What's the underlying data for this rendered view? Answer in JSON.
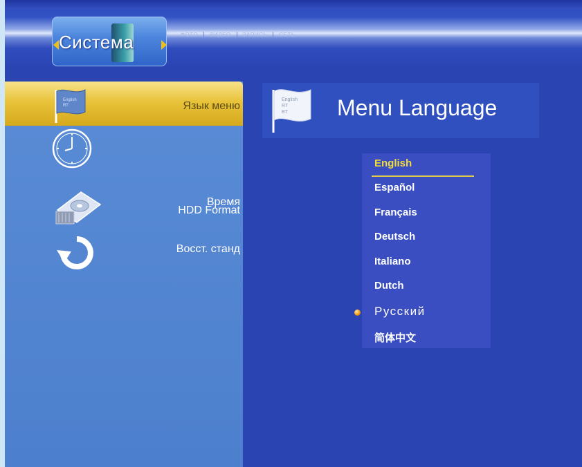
{
  "header": {
    "title": "Система",
    "tabs": [
      "ФОТО",
      "ВИДЕО",
      "ЗАПИСЬ",
      "СЕТЬ"
    ]
  },
  "menu": {
    "items": [
      {
        "label": "Язык меню",
        "icon": "flag-icon",
        "selected": true
      },
      {
        "label": "Время",
        "icon": "clock-icon",
        "selected": false
      },
      {
        "label": "HDD Format",
        "icon": "hard-drive-icon",
        "selected": false
      },
      {
        "label": "Восст. станд",
        "icon": "restore-icon",
        "selected": false
      }
    ]
  },
  "content": {
    "title": "Menu Language",
    "icon": "flag-icon",
    "languages": [
      "English",
      "Español",
      "Français",
      "Deutsch",
      "Italiano",
      "Dutch",
      "Русский",
      "简体中文"
    ],
    "highlighted": "English",
    "current": "Русский"
  },
  "colors": {
    "background": "#2a44b2",
    "menu_panel": "#4c7fcd",
    "selection": "#e8c33a",
    "highlight_text": "#f2dd36"
  }
}
